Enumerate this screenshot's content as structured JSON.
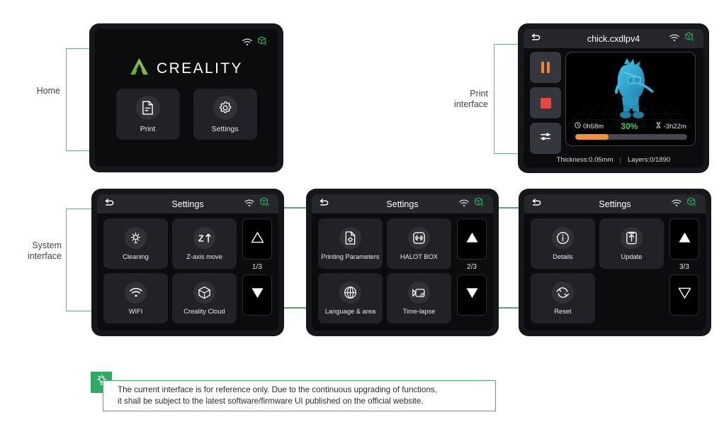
{
  "labels": {
    "home": "Home",
    "print_interface": "Print\ninterface",
    "print_interface_l1": "Print",
    "print_interface_l2": "interface",
    "system_interface_l1": "System",
    "system_interface_l2": "interface"
  },
  "home": {
    "brand": "CREALITY",
    "tiles": [
      {
        "label": "Print",
        "icon": "document-icon"
      },
      {
        "label": "Settings",
        "icon": "gear-icon"
      }
    ],
    "status": {
      "wifi": "wifi-icon",
      "cube": "cube-a-icon"
    }
  },
  "print": {
    "title": "chick.cxdlpv4",
    "back": "back-icon",
    "controls": [
      {
        "name": "pause-button",
        "icon": "pause-icon"
      },
      {
        "name": "stop-button",
        "icon": "stop-icon"
      },
      {
        "name": "adjust-button",
        "icon": "sliders-icon"
      }
    ],
    "elapsed": "0h58m",
    "percent": "30%",
    "percent_value": 30,
    "remaining": "-3h22m",
    "thickness": "Thickness:0.05mm",
    "layers": "Layers:0/1890",
    "separator": "|",
    "colors": {
      "progress": "#f0913f",
      "percent": "#49c85c",
      "pause": "#f08436",
      "stop": "#e8463f",
      "model": "#2fa6cf"
    }
  },
  "settings": {
    "title": "Settings",
    "back": "back-icon",
    "pages": [
      {
        "count": "1/3",
        "up_enabled": false,
        "down_enabled": true,
        "tiles": [
          {
            "label": "Cleaning",
            "icon": "brightness-icon"
          },
          {
            "label": "Z-axis move",
            "icon": "z-axis-icon"
          },
          {
            "label": "WIFI",
            "icon": "wifi-icon"
          },
          {
            "label": "Creality Cloud",
            "icon": "cube-icon"
          }
        ]
      },
      {
        "count": "2/3",
        "up_enabled": true,
        "down_enabled": true,
        "tiles": [
          {
            "label": "Printing Parameters",
            "icon": "file-gear-icon"
          },
          {
            "label": "HALOT BOX",
            "icon": "halot-box-icon"
          },
          {
            "label": "Language & area",
            "icon": "globe-icon"
          },
          {
            "label": "Time-lapse",
            "icon": "camera-icon"
          }
        ]
      },
      {
        "count": "3/3",
        "up_enabled": true,
        "down_enabled": false,
        "tiles": [
          {
            "label": "Details",
            "icon": "info-icon"
          },
          {
            "label": "Update",
            "icon": "update-icon"
          },
          {
            "label": "Reset",
            "icon": "reset-icon"
          }
        ]
      }
    ]
  },
  "note": {
    "icon": "lightbulb-icon",
    "line1": "The current interface is for reference only. Due to the continuous upgrading of functions,",
    "line2": "it shall be subject to the latest software/firmware UI published on the official website."
  }
}
